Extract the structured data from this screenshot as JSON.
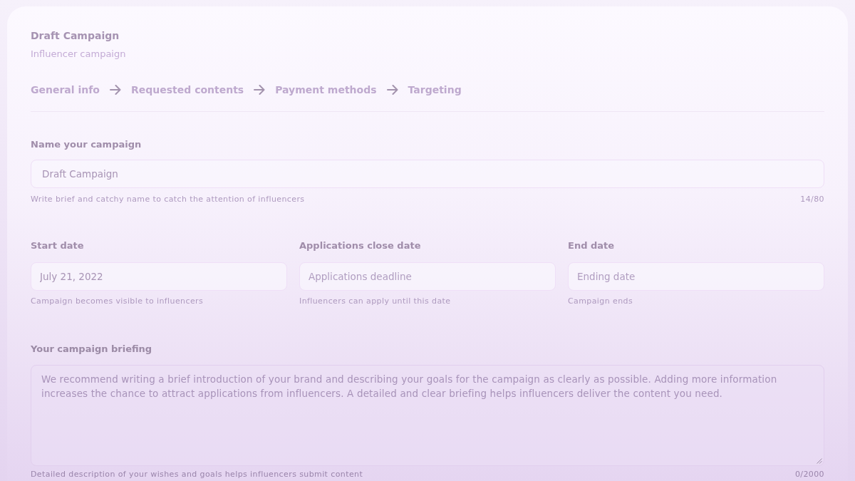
{
  "campaign": {
    "title": "Draft Campaign",
    "subtitle": "Influencer campaign"
  },
  "steps": [
    {
      "label": "General info"
    },
    {
      "label": "Requested contents"
    },
    {
      "label": "Payment methods"
    },
    {
      "label": "Targeting"
    }
  ],
  "name_field": {
    "label": "Name your campaign",
    "value": "Draft Campaign",
    "hint": "Write brief and catchy name to catch the attention of influencers",
    "counter": "14/80"
  },
  "date_fields": [
    {
      "label": "Start date",
      "value": "July 21, 2022",
      "hint": "Campaign becomes visible to influencers"
    },
    {
      "label": "Applications close date",
      "placeholder": "Applications deadline",
      "hint": "Influencers can apply until this date"
    },
    {
      "label": "End date",
      "placeholder": "Ending date",
      "hint": "Campaign ends"
    }
  ],
  "briefing": {
    "label": "Your campaign briefing",
    "placeholder": "We recommend writing a brief introduction of your brand and describing your goals for the campaign as clearly as possible. Adding more information increases the chance to attract applications from influencers. A detailed and clear briefing helps influencers deliver the content you need.",
    "hint": "Detailed description of your wishes and goals helps influencers submit content",
    "counter": "0/2000"
  }
}
